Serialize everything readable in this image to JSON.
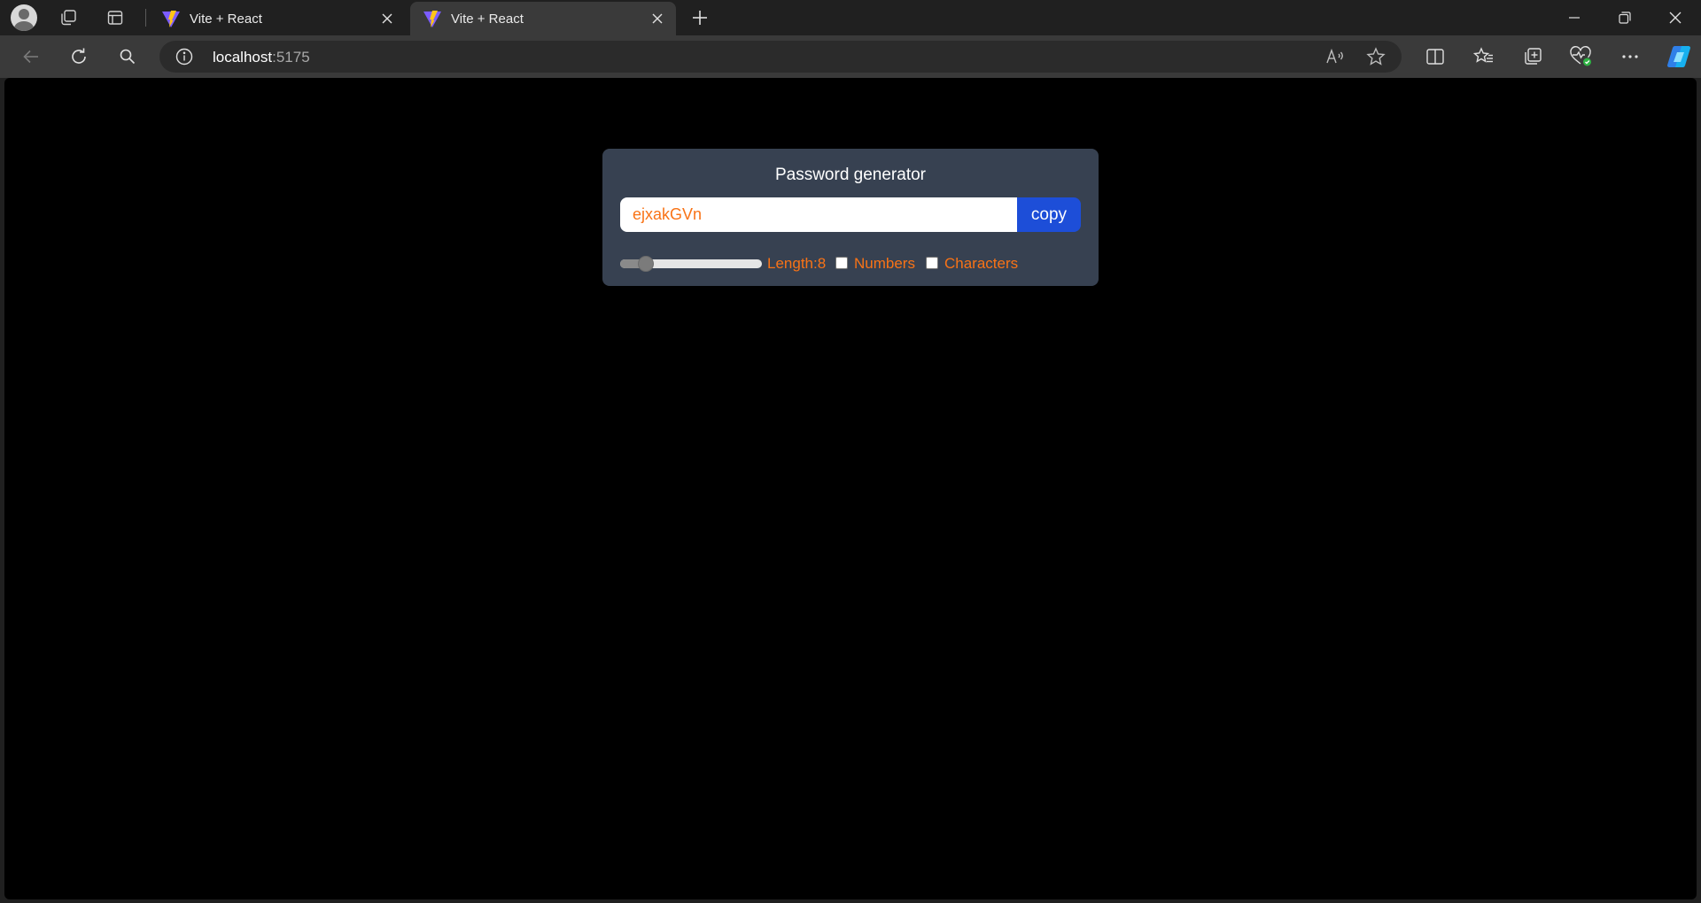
{
  "browser": {
    "tabs": [
      {
        "title": "Vite + React",
        "active": false
      },
      {
        "title": "Vite + React",
        "active": true
      }
    ],
    "address": {
      "host": "localhost",
      "port": ":5175"
    },
    "icons": {
      "profile": "avatar-icon",
      "workspaces": "workspaces-icon",
      "tab_actions": "vertical-tabs-icon",
      "tab_favicon": "vite-logo-icon",
      "close": "close-icon",
      "new_tab": "plus-icon",
      "back": "back-arrow-icon",
      "refresh": "refresh-icon",
      "search": "search-icon",
      "site_info": "info-icon",
      "read_aloud": "read-aloud-icon",
      "favorite": "star-icon",
      "split_screen": "split-screen-icon",
      "favorites": "favorites-icon",
      "collections": "collections-icon",
      "browser_essentials": "heart-pulse-icon",
      "more": "more-icon",
      "copilot": "copilot-icon"
    }
  },
  "app": {
    "title": "Password generator",
    "password": "ejxakGVn",
    "copy_label": "copy",
    "length": 8,
    "length_label": "Length:8",
    "length_fraction": 0.18,
    "numbers_label": "Numbers",
    "numbers_checked": false,
    "characters_label": "Characters",
    "characters_checked": false,
    "colors": {
      "page_background": "#000000",
      "card_background": "#374151",
      "accent_text": "#f97316",
      "button": "#1d4ed8"
    }
  }
}
